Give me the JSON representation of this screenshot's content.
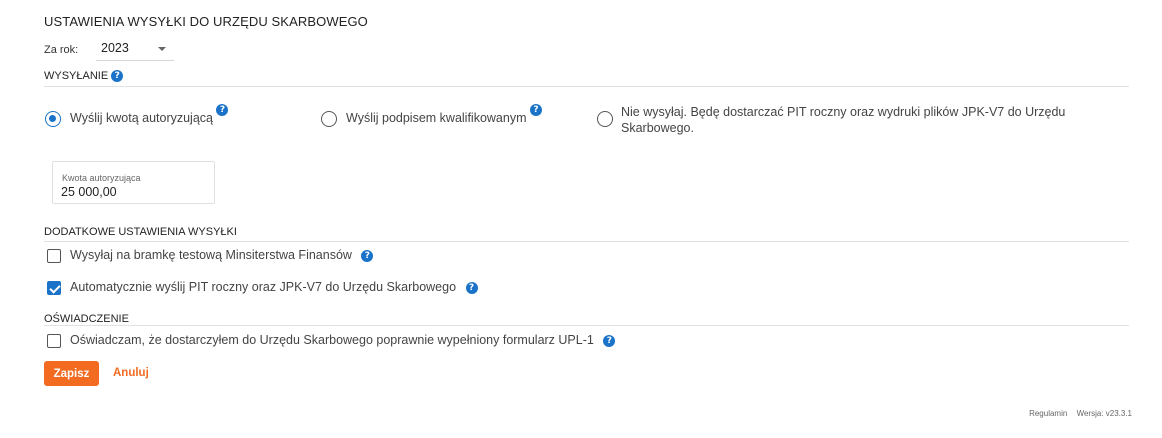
{
  "page": {
    "title": "USTAWIENIA WYSYŁKI DO URZĘDU SKARBOWEGO",
    "year_label": "Za rok:",
    "year_value": "2023"
  },
  "sending": {
    "title": "WYSYŁANIE",
    "options": [
      {
        "label": "Wyślij kwotą autoryzującą",
        "checked": true,
        "help": true
      },
      {
        "label": "Wyślij podpisem kwalifikowanym",
        "checked": false,
        "help": true
      },
      {
        "label_line1": "Nie wysyłaj. Będę dostarczać PIT roczny oraz wydruki plików JPK-V7 do Urzędu",
        "label_line2": "Skarbowego.",
        "checked": false,
        "help": false
      }
    ],
    "amount": {
      "label": "Kwota autoryzująca",
      "value": "25 000,00"
    }
  },
  "additional": {
    "title": "DODATKOWE USTAWIENIA WYSYŁKI",
    "options": [
      {
        "label": "Wysyłaj na bramkę testową Minsiterstwa Finansów",
        "checked": false
      },
      {
        "label": "Automatycznie wyślij PIT roczny oraz JPK-V7 do Urzędu Skarbowego",
        "checked": true
      }
    ]
  },
  "declaration": {
    "title": "OŚWIADCZENIE",
    "option": {
      "label": "Oświadczam, że dostarczyłem do Urzędu Skarbowego poprawnie wypełniony formularz UPL-1",
      "checked": false
    }
  },
  "actions": {
    "save": "Zapisz",
    "cancel": "Anuluj"
  },
  "footer": {
    "terms": "Regulamin",
    "version": "Wersja: v23.3.1"
  },
  "icons": {
    "help": "question-circle-icon",
    "dropdown": "chevron-down-icon"
  },
  "colors": {
    "accent": "#f26b21",
    "primary": "#1a73c9"
  }
}
